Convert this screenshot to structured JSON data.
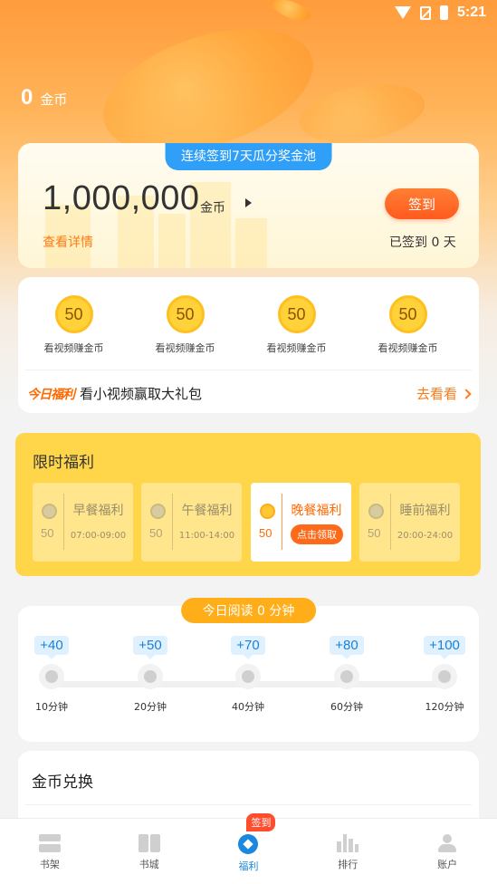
{
  "status_bar": {
    "time": "5:21"
  },
  "balance": {
    "amount": "0",
    "unit": "金币"
  },
  "sign_card": {
    "banner": "连续签到7天瓜分奖金池",
    "pool_amount": "1,000,000",
    "pool_unit": "金币",
    "details_link": "查看详情",
    "sign_button": "签到",
    "signed_status": "已签到 0 天"
  },
  "video_tasks": {
    "items": [
      {
        "coins": "50",
        "label": "看视频赚金币"
      },
      {
        "coins": "50",
        "label": "看视频赚金币"
      },
      {
        "coins": "50",
        "label": "看视频赚金币"
      },
      {
        "coins": "50",
        "label": "看视频赚金币"
      }
    ],
    "today_tag": "今日福利",
    "today_text": "看小视频赢取大礼包",
    "go_link": "去看看"
  },
  "limited_welfare": {
    "title": "限时福利",
    "slots": [
      {
        "amount": "50",
        "name": "早餐福利",
        "time": "07:00-09:00",
        "active": false
      },
      {
        "amount": "50",
        "name": "午餐福利",
        "time": "11:00-14:00",
        "active": false
      },
      {
        "amount": "50",
        "name": "晚餐福利",
        "claim_button": "点击领取",
        "active": true
      },
      {
        "amount": "50",
        "name": "睡前福利",
        "time": "20:00-24:00",
        "active": false
      }
    ]
  },
  "reading": {
    "banner": "今日阅读 0 分钟",
    "milestones": [
      {
        "reward": "+40",
        "label": "10分钟"
      },
      {
        "reward": "+50",
        "label": "20分钟"
      },
      {
        "reward": "+70",
        "label": "40分钟"
      },
      {
        "reward": "+80",
        "label": "60分钟"
      },
      {
        "reward": "+100",
        "label": "120分钟"
      }
    ]
  },
  "exchange": {
    "title": "金币兑换"
  },
  "bottom_nav": {
    "items": [
      {
        "label": "书架",
        "icon": "bookshelf-icon"
      },
      {
        "label": "书城",
        "icon": "bookstore-icon"
      },
      {
        "label": "福利",
        "icon": "welfare-icon",
        "active": true,
        "badge": "签到"
      },
      {
        "label": "排行",
        "icon": "ranking-icon"
      },
      {
        "label": "账户",
        "icon": "account-icon"
      }
    ]
  },
  "colors": {
    "accent_orange": "#ff6a00",
    "sign_button": "#ff5a1f",
    "banner_blue": "#2f9ff7",
    "limited_yellow": "#ffd64a",
    "active_nav_blue": "#1a88e0",
    "reward_blue": "#1b7fd4"
  }
}
